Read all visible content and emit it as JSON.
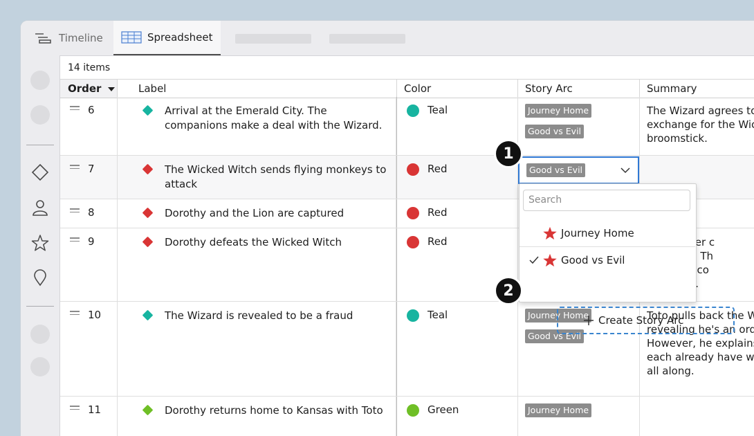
{
  "tabs": {
    "timeline": "Timeline",
    "spreadsheet": "Spreadsheet"
  },
  "table": {
    "item_count": "14 items",
    "headers": {
      "order": "Order",
      "label": "Label",
      "color": "Color",
      "story_arc": "Story Arc",
      "summary": "Summary"
    },
    "rows": [
      {
        "order": "6",
        "label": "Arrival at the Emerald City. The companions make a deal with the Wizard.",
        "color_name": "Teal",
        "color_hex": "#17b4a0",
        "arcs": [
          "Journey Home",
          "Good vs Evil"
        ],
        "summary": "The Wizard agrees to\nexchange for the Wic\nbroomstick."
      },
      {
        "order": "7",
        "label": "The Wicked Witch sends flying monkeys to attack",
        "color_name": "Red",
        "color_hex": "#d93535",
        "arcs": [
          "Good vs Evil"
        ],
        "summary": ""
      },
      {
        "order": "8",
        "label": "Dorothy and the Lion are captured",
        "color_name": "Red",
        "color_hex": "#d93535",
        "arcs": [],
        "summary": ""
      },
      {
        "order": "9",
        "label": "Dorothy defeats the Wicked Witch",
        "color_name": "Red",
        "color_hex": "#d93535",
        "arcs": [],
        "summary": "spills water c\nstoys her. Th\ncarry the co\nerald City."
      },
      {
        "order": "10",
        "label": "The Wizard is revealed to be a fraud",
        "color_name": "Teal",
        "color_hex": "#17b4a0",
        "arcs": [
          "Journey Home",
          "Good vs Evil"
        ],
        "summary": "Toto pulls back the W\nrevealing he's an ordi\nHowever, he explains\neach already have wh\nall along."
      },
      {
        "order": "11",
        "label": "Dorothy returns home to Kansas with Toto",
        "color_name": "Green",
        "color_hex": "#6fbf26",
        "arcs": [
          "Journey Home"
        ],
        "summary": ""
      }
    ]
  },
  "dropdown": {
    "search_placeholder": "Search",
    "options": [
      {
        "label": "Journey Home",
        "checked": false
      },
      {
        "label": "Good vs Evil",
        "checked": true
      }
    ],
    "create_label": "Create Story Arc"
  },
  "callouts": {
    "one": "1",
    "two": "2"
  },
  "colors": {
    "accent_blue": "#2f78d4",
    "star_red": "#d93535",
    "chip_gray": "#8c8c8c"
  }
}
